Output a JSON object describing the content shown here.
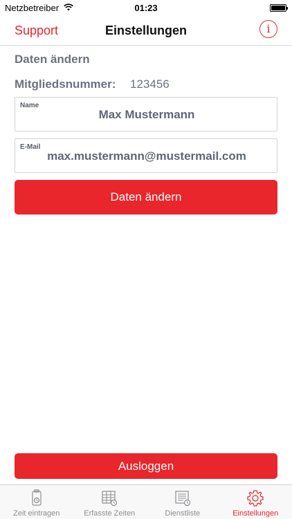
{
  "status_bar": {
    "carrier": "Netzbetreiber",
    "time": "01:23",
    "icons": [
      "wifi-icon",
      "battery-icon"
    ]
  },
  "nav": {
    "back_label": "Support",
    "title": "Einstellungen",
    "info_icon": "info-icon",
    "info_glyph": "i"
  },
  "content": {
    "section_title": "Daten ändern",
    "member_label": "Mitgliedsnummer:",
    "member_value": "123456",
    "name_field": {
      "label": "Name",
      "value": "Max Mustermann"
    },
    "email_field": {
      "label": "E-Mail",
      "value": "max.mustermann@mustermail.com"
    },
    "change_button": "Daten ändern",
    "logout_button": "Ausloggen"
  },
  "tabs": [
    {
      "label": "Zeit eintragen",
      "icon": "timer-icon",
      "active": false
    },
    {
      "label": "Erfasste Zeiten",
      "icon": "table-clock-icon",
      "active": false
    },
    {
      "label": "Dienstliste",
      "icon": "list-clock-icon",
      "active": false
    },
    {
      "label": "Einstellungen",
      "icon": "gear-icon",
      "active": true
    }
  ],
  "colors": {
    "accent": "#e8262b",
    "text_gray": "#6b7280",
    "tab_inactive": "#8e8e93"
  }
}
